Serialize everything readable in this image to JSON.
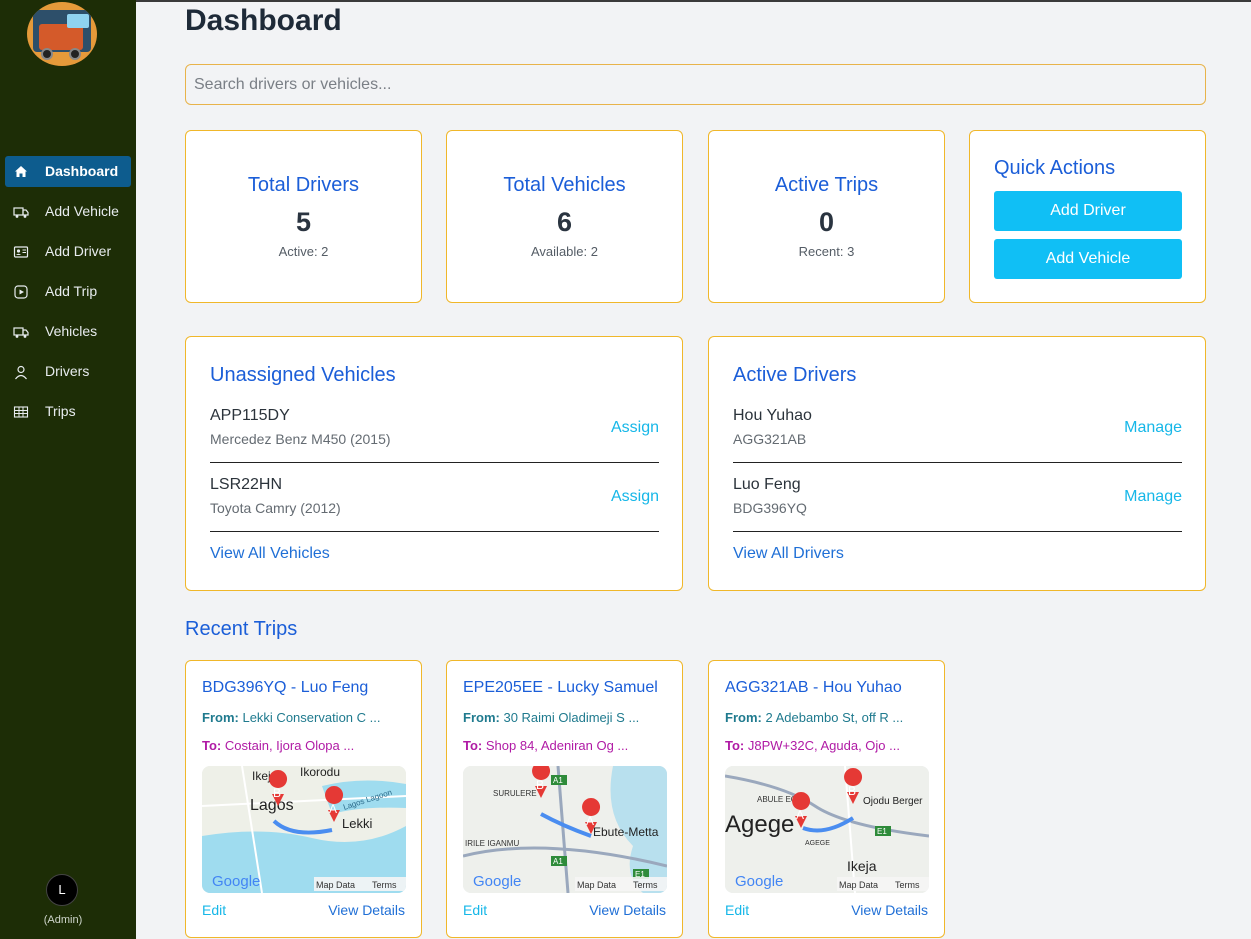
{
  "sidebar": {
    "items": [
      {
        "label": "Dashboard",
        "icon": "home-icon",
        "active": true
      },
      {
        "label": "Add Vehicle",
        "icon": "truck-plus-icon",
        "active": false
      },
      {
        "label": "Add Driver",
        "icon": "id-card-icon",
        "active": false
      },
      {
        "label": "Add Trip",
        "icon": "plus-circle-icon",
        "active": false
      },
      {
        "label": "Vehicles",
        "icon": "truck-icon",
        "active": false
      },
      {
        "label": "Drivers",
        "icon": "user-icon",
        "active": false
      },
      {
        "label": "Trips",
        "icon": "route-icon",
        "active": false
      }
    ],
    "avatar_initial": "L",
    "role": "(Admin)"
  },
  "header": {
    "title": "Dashboard"
  },
  "search": {
    "placeholder": "Search drivers or vehicles..."
  },
  "stats": [
    {
      "title": "Total Drivers",
      "value": "5",
      "sub": "Active: 2"
    },
    {
      "title": "Total Vehicles",
      "value": "6",
      "sub": "Available: 2"
    },
    {
      "title": "Active Trips",
      "value": "0",
      "sub": "Recent: 3"
    }
  ],
  "quick_actions": {
    "title": "Quick Actions",
    "add_driver": "Add Driver",
    "add_vehicle": "Add Vehicle"
  },
  "unassigned": {
    "title": "Unassigned Vehicles",
    "rows": [
      {
        "plate": "APP115DY",
        "model": "Mercedez Benz M450 (2015)",
        "action": "Assign"
      },
      {
        "plate": "LSR22HN",
        "model": "Toyota Camry (2012)",
        "action": "Assign"
      }
    ],
    "view_all": "View All Vehicles"
  },
  "active_drivers": {
    "title": "Active Drivers",
    "rows": [
      {
        "name": "Hou Yuhao",
        "plate": "AGG321AB",
        "action": "Manage"
      },
      {
        "name": "Luo Feng",
        "plate": "BDG396YQ",
        "action": "Manage"
      }
    ],
    "view_all": "View All Drivers"
  },
  "recent_trips": {
    "title": "Recent Trips",
    "from_label": "From:",
    "to_label": "To:",
    "edit_label": "Edit",
    "details_label": "View Details",
    "trips": [
      {
        "title": "BDG396YQ - Luo Feng",
        "from": "Lekki Conservation C ...",
        "to": "Costain, Ijora Olopa ...",
        "map_places": [
          "Ikeja",
          "Ikorodu",
          "Lagos",
          "Lekki",
          "Lagos Lagoon"
        ]
      },
      {
        "title": "EPE205EE - Lucky Samuel",
        "from": "30 Raimi Oladimeji S ...",
        "to": "Shop 84, Adeniran Og ...",
        "map_places": [
          "SURULERE",
          "Ebute-Metta",
          "IRILE IGANMU",
          "A1",
          "E1"
        ]
      },
      {
        "title": "AGG321AB - Hou Yuhao",
        "from": "2 Adebambo St, off R ...",
        "to": "J8PW+32C, Aguda, Ojo ...",
        "map_places": [
          "ABULE EGBA",
          "Agege",
          "Ojodu Berger",
          "AGEGE",
          "Ikeja",
          "E1"
        ]
      }
    ],
    "map_footer": {
      "brand": "Google",
      "data": "Map Data",
      "terms": "Terms"
    }
  }
}
